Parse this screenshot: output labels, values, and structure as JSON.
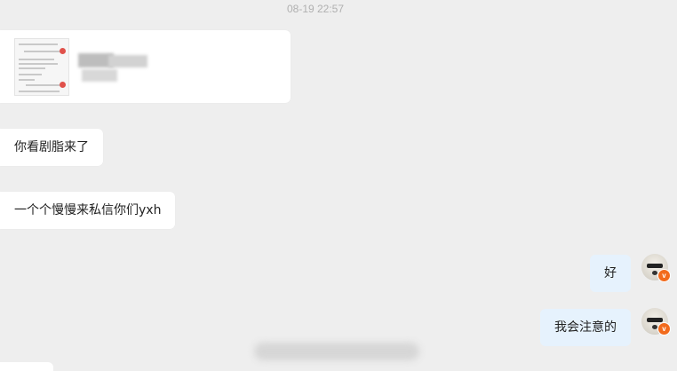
{
  "chat": {
    "timestamp": "08-19 22:57",
    "messages": [
      {
        "side": "left",
        "type": "image",
        "description_icon": "screenshot-thumbnail"
      },
      {
        "side": "left",
        "type": "text",
        "text": "你看剧脂来了"
      },
      {
        "side": "left",
        "type": "text",
        "text": "一个个慢慢来私信你们yxh"
      },
      {
        "side": "right",
        "type": "text",
        "text": "好"
      },
      {
        "side": "right",
        "type": "text",
        "text": "我会注意的"
      }
    ],
    "avatar_badge": "v"
  },
  "colors": {
    "background": "#eeeeee",
    "incoming_bubble": "#ffffff",
    "outgoing_bubble": "#e6f2fd",
    "badge": "#f26b1d"
  }
}
